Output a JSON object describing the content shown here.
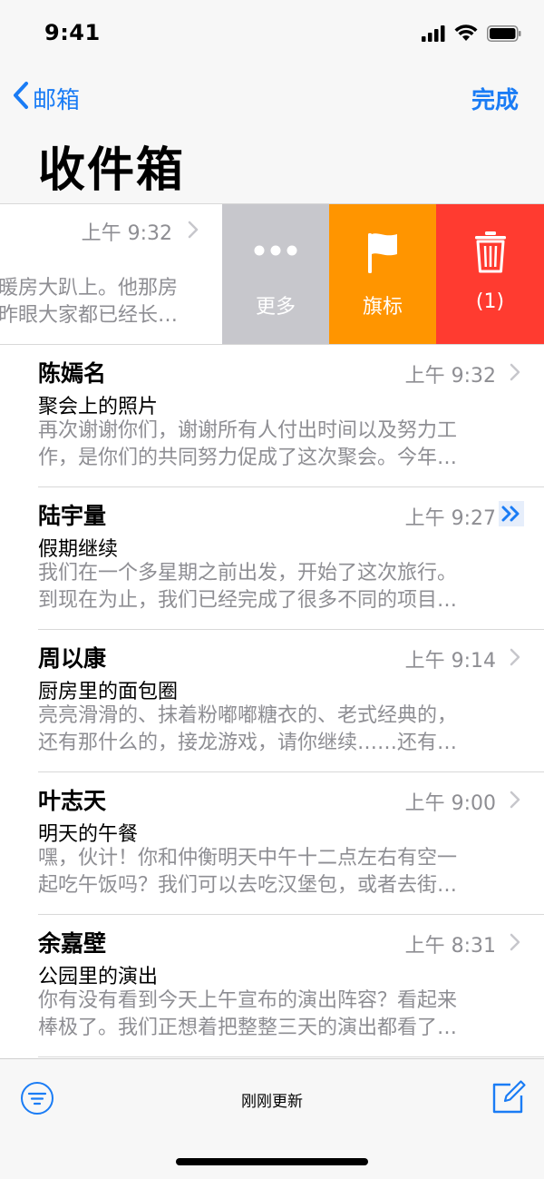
{
  "status_bar": {
    "time": "9:41"
  },
  "nav": {
    "back_label": "邮箱",
    "done_label": "完成",
    "title": "收件箱"
  },
  "swiped_message": {
    "time": "上午 9:32",
    "preview_line1": "暖房大趴上。他那房",
    "preview_line2": "昨眼大家都已经长…",
    "actions": {
      "more": "更多",
      "flag": "旗标",
      "trash": "(1)"
    },
    "colors": {
      "more": "#c7c7cc",
      "flag": "#ff9500",
      "trash": "#ff3b30"
    }
  },
  "messages": [
    {
      "sender": "陈嫣名",
      "time": "上午 9:32",
      "subject": "聚会上的照片",
      "preview_line1": "再次谢谢你们，谢谢所有人付出时间以及努力工",
      "preview_line2": "作，是你们的共同努力促成了这次聚会。今年…",
      "vip": false
    },
    {
      "sender": "陆宇量",
      "time": "上午 9:27",
      "subject": "假期继续",
      "preview_line1": "我们在一个多星期之前出发，开始了这次旅行。",
      "preview_line2": "到现在为止，我们已经完成了很多不同的项目…",
      "vip": true
    },
    {
      "sender": "周以康",
      "time": "上午 9:14",
      "subject": "厨房里的面包圈",
      "preview_line1": "亮亮滑滑的、抹着粉嘟嘟糖衣的、老式经典的，",
      "preview_line2": "还有那什么的，接龙游戏，请你继续……还有…",
      "vip": false
    },
    {
      "sender": "叶志天",
      "time": "上午 9:00",
      "subject": "明天的午餐",
      "preview_line1": "嘿，伙计！你和仲衡明天中午十二点左右有空一",
      "preview_line2": "起吃午饭吗？我们可以去吃汉堡包，或者去街…",
      "vip": false
    },
    {
      "sender": "余嘉壁",
      "time": "上午 8:31",
      "subject": "公园里的演出",
      "preview_line1": "你有没有看到今天上午宣布的演出阵容？看起来",
      "preview_line2": "棒极了。我们正想着把整整三天的演出都看了…",
      "vip": false
    }
  ],
  "toolbar": {
    "status": "刚刚更新"
  },
  "theme": {
    "accent": "#1a7cf5",
    "secondary_text": "#8e8e93"
  }
}
